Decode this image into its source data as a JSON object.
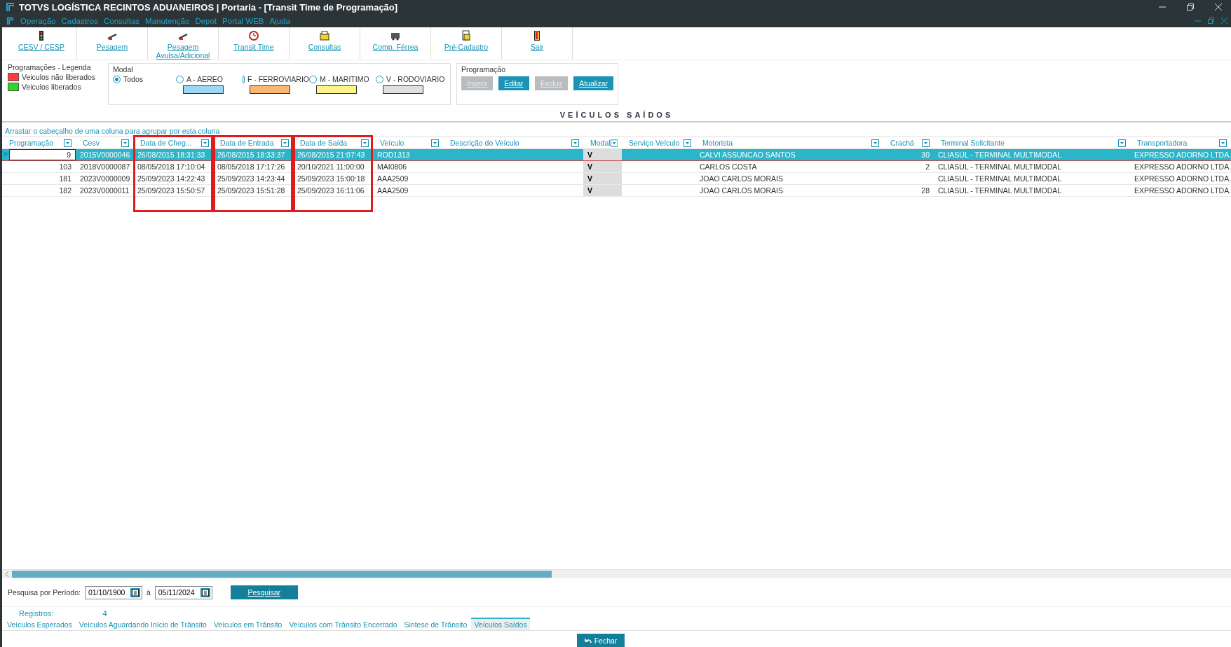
{
  "window": {
    "title": "TOTVS LOGÍSTICA RECINTOS ADUANEIROS | Portaria - [Transit Time de Programação]"
  },
  "menu": [
    "Operação",
    "Cadastros",
    "Consultas",
    "Manutenção",
    "Depot",
    "Portal WEB",
    "Ajuda"
  ],
  "toolbar": [
    {
      "kind": "traffic",
      "label": "CESV / CESP"
    },
    {
      "kind": "scale",
      "label": "Pesagem"
    },
    {
      "kind": "scale",
      "label": "Pesagem Avulsa/Adicional"
    },
    {
      "kind": "clock",
      "label": "Transit Time"
    },
    {
      "kind": "printer",
      "label": "Consultas"
    },
    {
      "kind": "train",
      "label": "Comp. Férrea"
    },
    {
      "kind": "doc",
      "label": "Pré-Cadastro"
    },
    {
      "kind": "exit",
      "label": "Sair"
    }
  ],
  "legend": {
    "title": "Programações - Legenda",
    "items": [
      {
        "label": "Veiculos não liberados",
        "color": "#ff3b3b"
      },
      {
        "label": "Veiculos liberados",
        "color": "#22dd22"
      }
    ]
  },
  "modal": {
    "title": "Modal",
    "options": [
      {
        "label": "Todos",
        "selected": true
      },
      {
        "label": "A - AEREO",
        "selected": false,
        "color": "#9ad8f5"
      },
      {
        "label": "F - FERROVIARIO",
        "selected": false,
        "color": "#fbb574"
      },
      {
        "label": "M - MARITIMO",
        "selected": false,
        "color": "#fbf585"
      },
      {
        "label": "V - RODOVIARIO",
        "selected": false,
        "color": "#e0e0e0"
      }
    ]
  },
  "programacao": {
    "title": "Programação",
    "buttons": [
      {
        "label": "Inserir",
        "disabled": true
      },
      {
        "label": "Editar",
        "disabled": false
      },
      {
        "label": "Excluir",
        "disabled": true
      },
      {
        "label": "Atualizar",
        "disabled": false
      }
    ]
  },
  "grid": {
    "title": "VEÍCULOS SAÍDOS",
    "group_hint": "Arrastar o cabeçalho de uma coluna para agrupar por esta coluna",
    "columns": [
      {
        "label": "Programação",
        "highlighted": false
      },
      {
        "label": "Cesv",
        "highlighted": false
      },
      {
        "label": "Data de Cheg...",
        "highlighted": true
      },
      {
        "label": "Data de Entrada",
        "highlighted": true
      },
      {
        "label": "Data de Saída",
        "highlighted": true
      },
      {
        "label": "Veículo",
        "highlighted": false
      },
      {
        "label": "Descrição do Veículo",
        "highlighted": false
      },
      {
        "label": "Modal",
        "highlighted": false
      },
      {
        "label": "Serviço Veículo",
        "highlighted": false
      },
      {
        "label": "Motorista",
        "highlighted": false
      },
      {
        "label": "Crachá",
        "highlighted": false
      },
      {
        "label": "Terminal Solicitante",
        "highlighted": false
      },
      {
        "label": "Transportadora",
        "highlighted": false
      }
    ],
    "rows": [
      {
        "selected": true,
        "cells": [
          "9",
          "2015V0000046",
          "26/08/2015 18:31:33",
          "26/08/2015 18:33:37",
          "26/08/2015 21:07:43",
          "ROD1313",
          "",
          "V",
          "",
          "CALVI ASSUNCAO SANTOS",
          "30",
          "CLIASUL - TERMINAL MULTIMODAL",
          "EXPRESSO ADORNO LTDA."
        ]
      },
      {
        "selected": false,
        "cells": [
          "103",
          "2018V0000087",
          "08/05/2018 17:10:04",
          "08/05/2018 17:17:26",
          "20/10/2021 11:00:00",
          "MAI0806",
          "",
          "V",
          "",
          "CARLOS COSTA",
          "2",
          "CLIASUL - TERMINAL MULTIMODAL",
          "EXPRESSO ADORNO LTDA."
        ]
      },
      {
        "selected": false,
        "cells": [
          "181",
          "2023V0000009",
          "25/09/2023 14:22:43",
          "25/09/2023 14:23:44",
          "25/09/2023 15:00:18",
          "AAA2509",
          "",
          "V",
          "",
          "JOAO CARLOS MORAIS",
          "",
          "CLIASUL - TERMINAL MULTIMODAL",
          "EXPRESSO ADORNO LTDA."
        ]
      },
      {
        "selected": false,
        "cells": [
          "182",
          "2023V0000011",
          "25/09/2023 15:50:57",
          "25/09/2023 15:51:28",
          "25/09/2023 16:11:06",
          "AAA2509",
          "",
          "V",
          "",
          "JOAO CARLOS MORAIS",
          "28",
          "CLIASUL - TERMINAL MULTIMODAL",
          "EXPRESSO ADORNO LTDA."
        ]
      }
    ]
  },
  "search": {
    "label": "Pesquisa  por Período:",
    "from": "01/10/1900",
    "separator": "à",
    "to": "05/11/2024",
    "button": "Pesquisar"
  },
  "records": {
    "label": "Registros:",
    "value": "4"
  },
  "tabs": [
    {
      "label": "Veículos Esperados",
      "selected": false
    },
    {
      "label": "Veículos Aguardando Início de Trânsito",
      "selected": false
    },
    {
      "label": "Veículos em Trânsito",
      "selected": false
    },
    {
      "label": "Veículos com Trânsito Encerrado",
      "selected": false
    },
    {
      "label": "Sintese de Trânsito",
      "selected": false
    },
    {
      "label": "Veículos Saídos",
      "selected": true
    }
  ],
  "close_button": "Fechar"
}
